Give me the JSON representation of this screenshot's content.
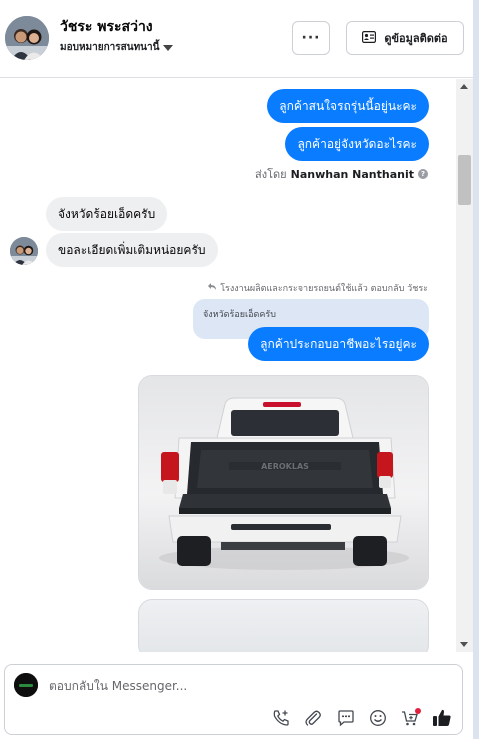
{
  "header": {
    "contact_name": "วัชระ พระสว่าง",
    "assigned_label": "มอบหมายการสนทนานี้",
    "more_label": "···",
    "view_contact_label": "ดูข้อมูลติดต่อ"
  },
  "messages": {
    "out_1": "ลูกค้าสนใจรถรุ่นนี้อยู่นะคะ",
    "out_2": "ลูกค้าอยู่จังหวัดอะไรคะ",
    "sent_by_prefix": "ส่งโดย",
    "sent_by_name": "Nanwhan Nanthanit",
    "in_1": "จังหวัดร้อยเอ็ดครับ",
    "in_2": "ขอละเอียดเพิ่มเติมหน่อยครับ",
    "reply_meta": "โรงงานผลิตและกระจายรถยนต์ใช้แล้ว ตอบกลับ วัชระ",
    "quoted_text": "จังหวัดร้อยเอ็ดครับ",
    "out_3": "ลูกค้าประกอบอาชีพอะไรอยู่คะ",
    "photo_brand_text": "AEROKLAS"
  },
  "composer": {
    "placeholder": "ตอบกลับใน Messenger..."
  },
  "icons": {
    "tools": [
      "phone-add-icon",
      "attachment-icon",
      "saved-reply-icon",
      "emoji-icon",
      "cart-icon",
      "like-icon"
    ]
  },
  "colors": {
    "outgoing_bubble": "#0a7cff",
    "incoming_bubble": "#eeeff1",
    "like_icon": "#1c1e21",
    "notify_dot": "#e41e3f"
  }
}
